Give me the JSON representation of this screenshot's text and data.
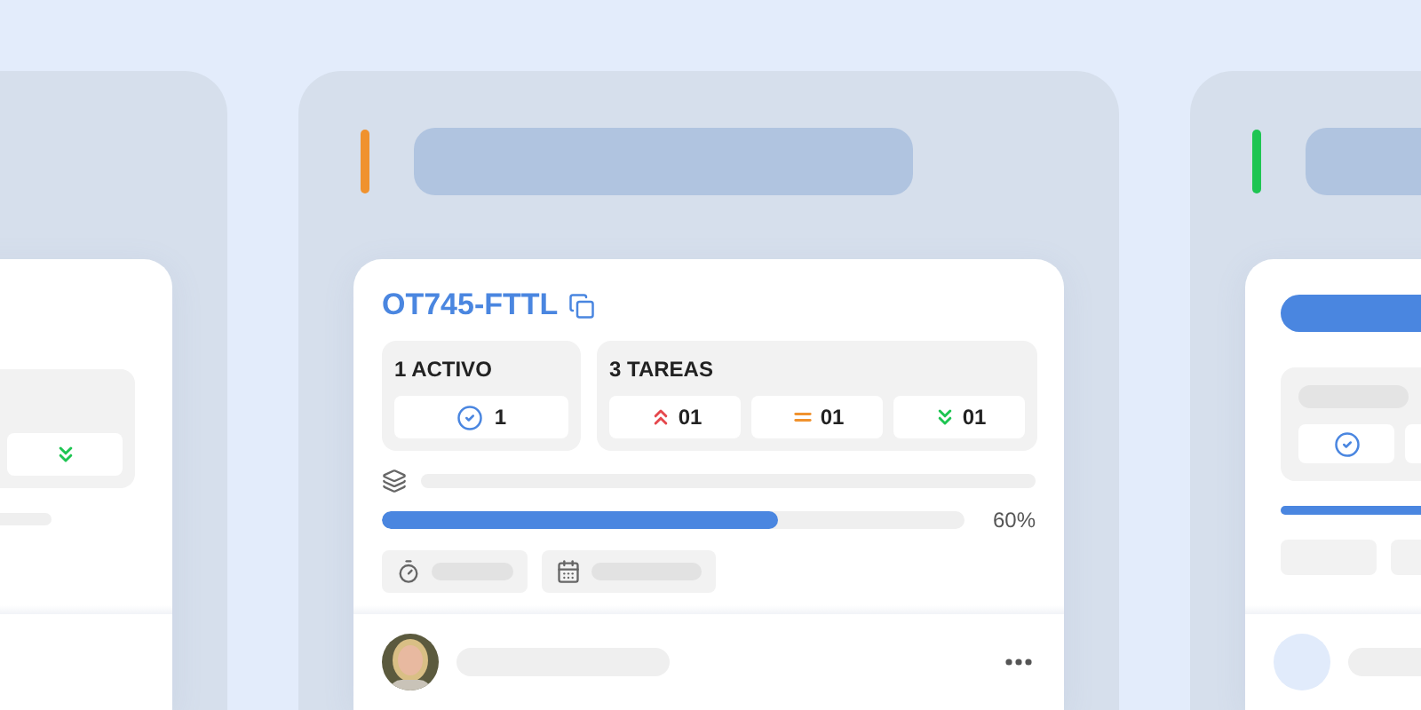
{
  "columns": [
    {
      "kind": "partial"
    },
    {
      "kind": "detailed",
      "color": "#f0922e",
      "card": {
        "title": "OT745-FTTL",
        "assets": {
          "label": "1 ACTIVO",
          "count": "1"
        },
        "tasks": {
          "label": "3 TAREAS",
          "items": [
            {
              "kind": "high",
              "count": "01"
            },
            {
              "kind": "medium",
              "count": "01"
            },
            {
              "kind": "low",
              "count": "01"
            }
          ]
        },
        "progress": {
          "level": 0.68,
          "reading": "60%"
        }
      }
    },
    {
      "kind": "skeleton",
      "color": "#1ec552"
    }
  ]
}
